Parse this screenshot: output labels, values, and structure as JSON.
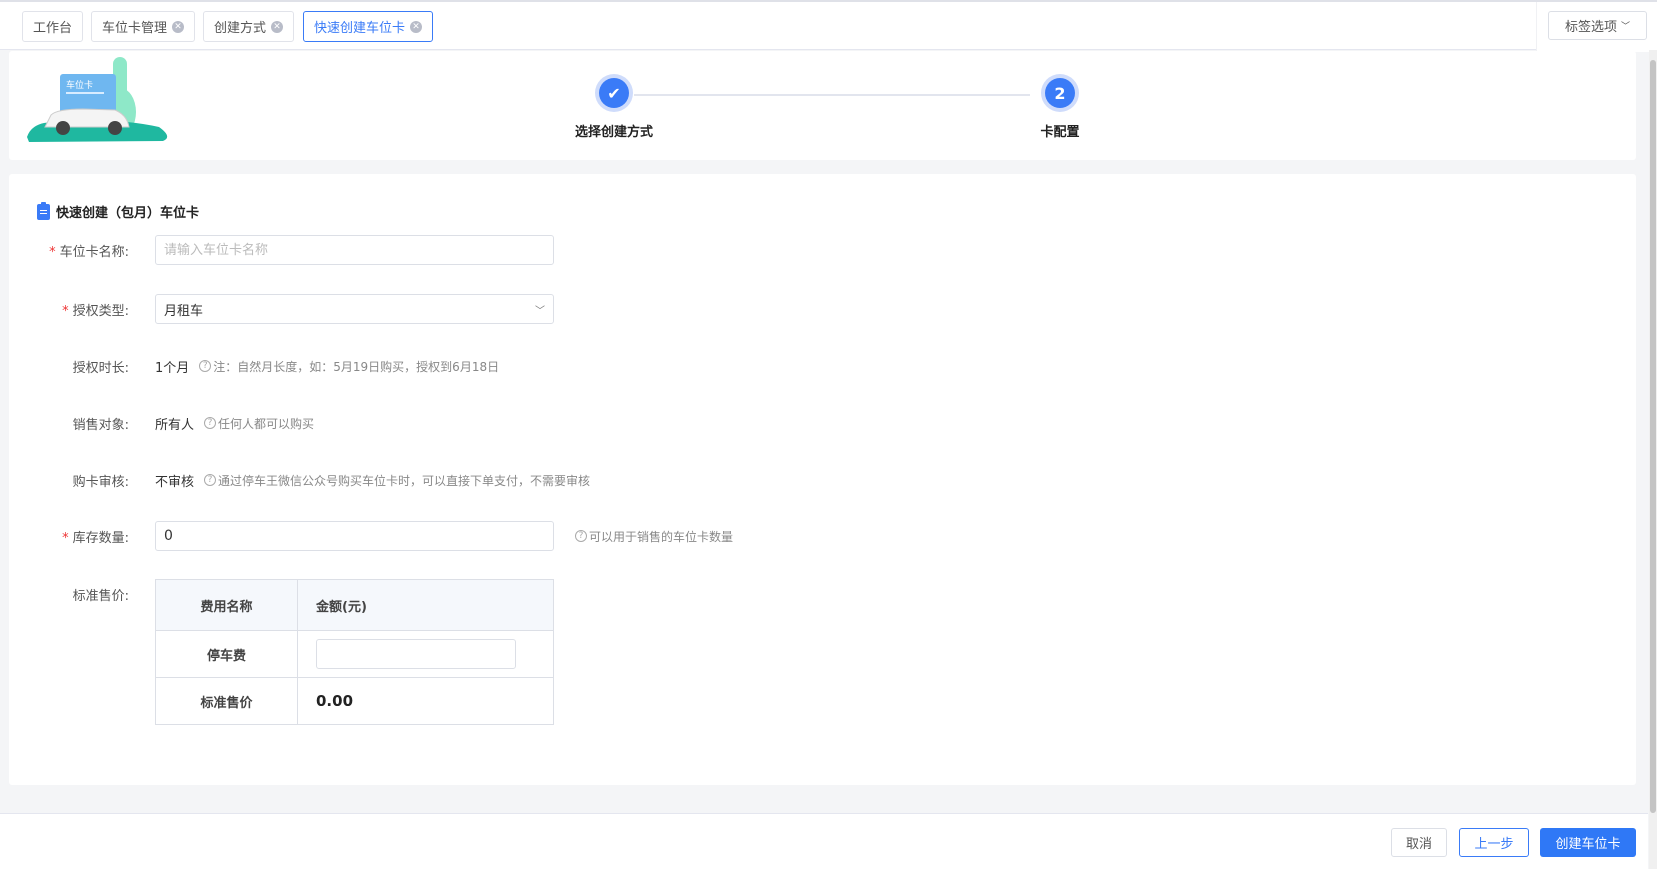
{
  "tabs": [
    {
      "label": "工作台",
      "closable": false
    },
    {
      "label": "车位卡管理",
      "closable": true
    },
    {
      "label": "创建方式",
      "closable": true
    },
    {
      "label": "快速创建车位卡",
      "closable": true,
      "active": true
    }
  ],
  "tag_options": "标签选项",
  "illustration_text": "车位卡",
  "steps": [
    {
      "label": "选择创建方式",
      "icon": "check-icon",
      "mark": "✔"
    },
    {
      "label": "卡配置",
      "mark": "2"
    }
  ],
  "form": {
    "title": "快速创建（包月）车位卡",
    "name": {
      "label": "车位卡名称:",
      "placeholder": "请输入车位卡名称",
      "value": ""
    },
    "auth_type": {
      "label": "授权类型:",
      "value": "月租车"
    },
    "duration": {
      "label": "授权时长:",
      "value": "1个月",
      "hint": "注：自然月长度，如：5月19日购买，授权到6月18日"
    },
    "sale_target": {
      "label": "销售对象:",
      "value": "所有人",
      "hint": "任何人都可以购买"
    },
    "review": {
      "label": "购卡审核:",
      "value": "不审核",
      "hint": "通过停车王微信公众号购买车位卡时，可以直接下单支付，不需要审核"
    },
    "stock": {
      "label": "库存数量:",
      "value": "0",
      "hint": "可以用于销售的车位卡数量"
    },
    "price": {
      "label": "标准售价:",
      "col1": "费用名称",
      "col2": "金额(元)",
      "fee_name": "停车费",
      "fee_value": "",
      "total_label": "标准售价",
      "total_value": "0.00"
    }
  },
  "footer": {
    "cancel": "取消",
    "prev": "上一步",
    "create": "创建车位卡"
  },
  "colors": {
    "accent": "#3a7bf7",
    "required": "#e33333"
  }
}
